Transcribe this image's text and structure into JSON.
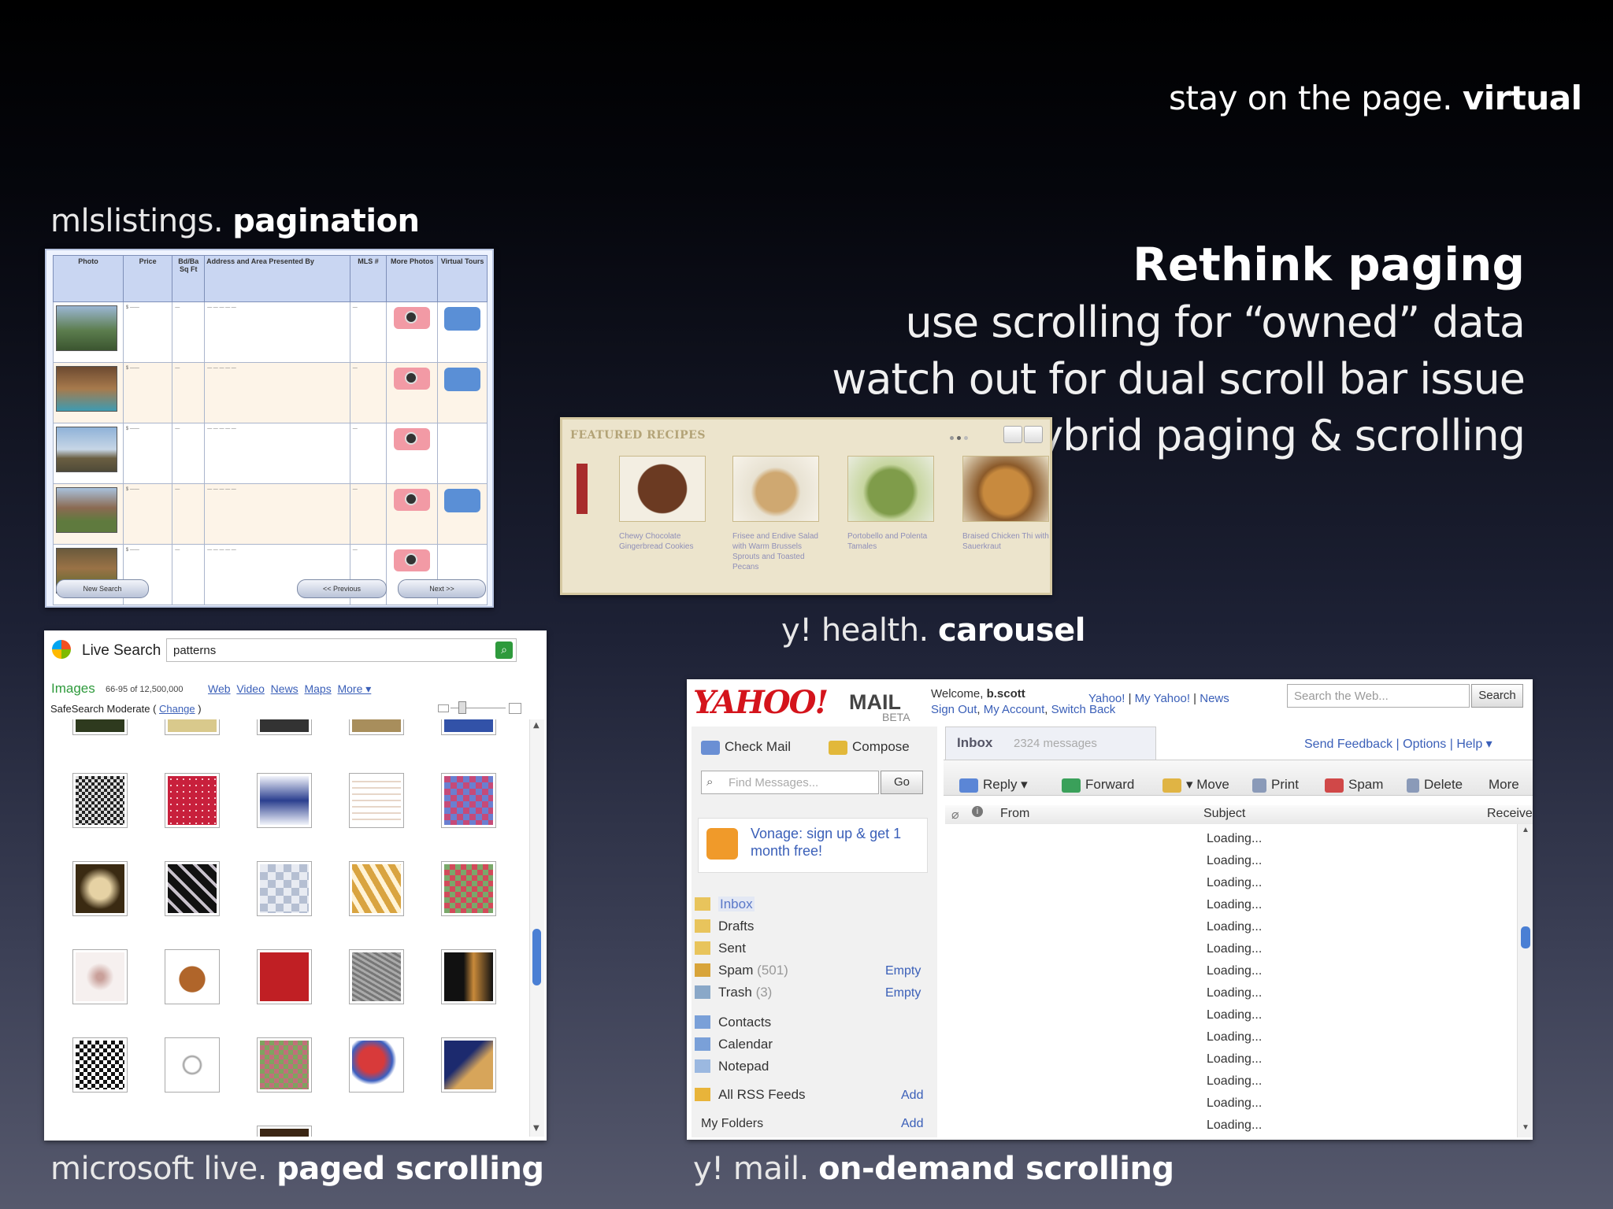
{
  "slide": {
    "corner_title": {
      "normal": "stay on the page.",
      "bold": "virtual"
    },
    "heading": "Rethink paging",
    "bullets": [
      "use scrolling for “owned” data",
      "watch out for dual scroll bar issue",
      "hybrid paging & scrolling"
    ],
    "captions": {
      "mls": {
        "normal": "mlslistings.",
        "bold": "pagination"
      },
      "carousel": {
        "normal": "y! health.",
        "bold": "carousel"
      },
      "live": {
        "normal": "microsoft live.",
        "bold": "paged scrolling"
      },
      "ymail": {
        "normal": "y! mail.",
        "bold": "on-demand scrolling"
      }
    }
  },
  "mls": {
    "headers": [
      "Photo",
      "Price",
      "Bd/Ba Sq Ft",
      "Address and Area Presented By",
      "MLS #",
      "More Photos",
      "Virtual Tours"
    ],
    "buttons": {
      "new_search": "New Search",
      "previous": "<< Previous",
      "next": "Next >>"
    }
  },
  "carousel": {
    "title": "FEATURED RECIPES",
    "items": [
      {
        "caption": "Chewy Chocolate Gingerbread Cookies",
        "color": "#6b3a22"
      },
      {
        "caption": "Frisee and Endive Salad with Warm Brussels Sprouts and Toasted Pecans",
        "color": "#cfa871"
      },
      {
        "caption": "Portobello and Polenta Tamales",
        "color": "#7f9c4a"
      },
      {
        "caption": "Braised Chicken Thi with Sauerkraut",
        "color": "#c88a3e"
      }
    ]
  },
  "live": {
    "brand": "Live Search",
    "query": "patterns",
    "section": "Images",
    "count": "66-95 of 12,500,000",
    "links": [
      "Web",
      "Video",
      "News",
      "Maps",
      "More ▾"
    ],
    "safesearch": "SafeSearch Moderate",
    "change": "Change"
  },
  "ymail": {
    "logo": "YAHOO!",
    "logo_mail": "MAIL",
    "beta": "BETA",
    "welcome": "Welcome,",
    "user": "b.scott",
    "header_links": [
      "Sign Out",
      "My Account",
      "Switch Back"
    ],
    "top_links": [
      "Yahoo!",
      "My Yahoo!",
      "News"
    ],
    "search_placeholder": "Search the Web...",
    "search_button": "Search",
    "check_mail": "Check Mail",
    "compose": "Compose",
    "find_placeholder": "Find Messages...",
    "go": "Go",
    "ad": "Vonage: sign up & get 1 month free!",
    "inbox_tab": "Inbox",
    "inbox_count": "2324 messages",
    "feedback_links": [
      "Send Feedback",
      "Options",
      "Help ▾"
    ],
    "toolbar": [
      "Reply ▾",
      "Forward",
      "▾ Move",
      "Print",
      "Spam",
      "Delete",
      "More"
    ],
    "columns": {
      "from": "From",
      "subject": "Subject",
      "received": "Receive"
    },
    "folders": [
      {
        "name": "Inbox",
        "count": "",
        "action": ""
      },
      {
        "name": "Drafts",
        "count": "",
        "action": ""
      },
      {
        "name": "Sent",
        "count": "",
        "action": ""
      },
      {
        "name": "Spam",
        "count": "(501)",
        "action": "Empty"
      },
      {
        "name": "Trash",
        "count": "(3)",
        "action": "Empty"
      }
    ],
    "extras": [
      "Contacts",
      "Calendar",
      "Notepad"
    ],
    "rss": "All RSS Feeds",
    "rss_action": "Add",
    "my_folders": "My Folders",
    "my_folders_action": "Add",
    "loading": "Loading..."
  }
}
